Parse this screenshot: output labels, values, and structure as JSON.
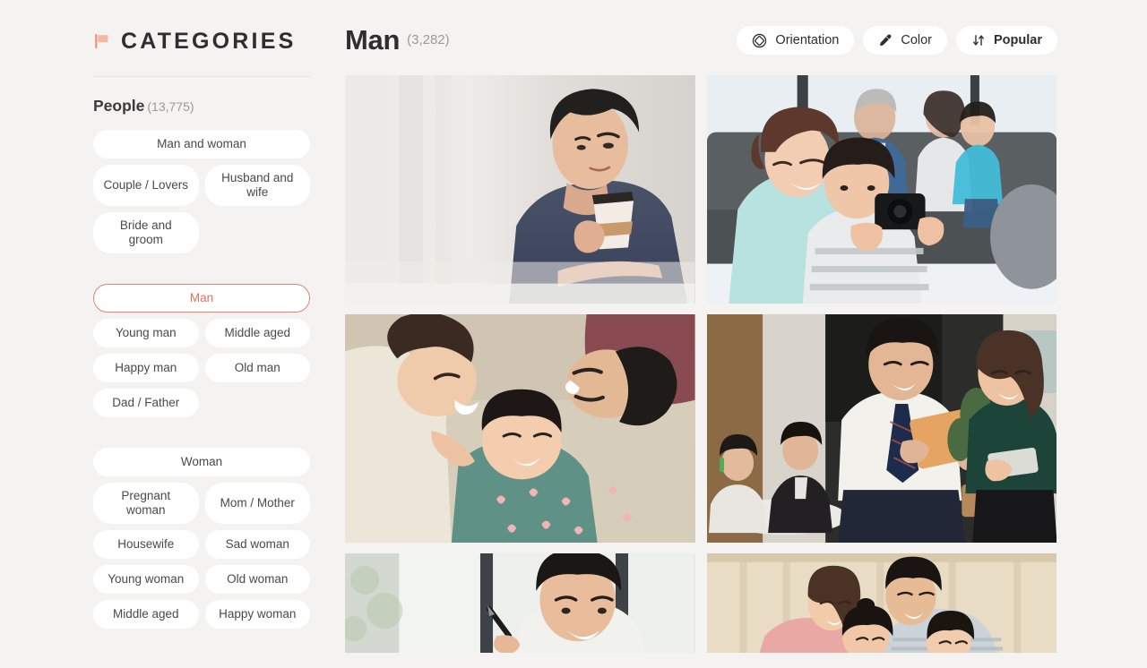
{
  "sidebar": {
    "header": {
      "icon": "flag-icon",
      "title": "CATEGORIES"
    },
    "group": {
      "name": "People",
      "count": "(13,775)"
    },
    "sections": [
      {
        "id": "man-and-woman",
        "pills": [
          {
            "label": "Man and woman",
            "width": "full",
            "selected": false
          },
          {
            "label": "Couple / Lovers",
            "width": "half",
            "selected": false
          },
          {
            "label": "Husband and wife",
            "width": "half",
            "selected": false,
            "two_line": true
          },
          {
            "label": "Bride and groom",
            "width": "half",
            "selected": false,
            "two_line": true
          }
        ]
      },
      {
        "id": "man",
        "pills": [
          {
            "label": "Man",
            "width": "full",
            "selected": true
          },
          {
            "label": "Young man",
            "width": "half",
            "selected": false
          },
          {
            "label": "Middle aged",
            "width": "half",
            "selected": false
          },
          {
            "label": "Happy man",
            "width": "half",
            "selected": false
          },
          {
            "label": "Old man",
            "width": "half",
            "selected": false
          },
          {
            "label": "Dad / Father",
            "width": "half",
            "selected": false
          }
        ]
      },
      {
        "id": "woman",
        "pills": [
          {
            "label": "Woman",
            "width": "full",
            "selected": false
          },
          {
            "label": "Pregnant woman",
            "width": "half",
            "selected": false,
            "two_line": true
          },
          {
            "label": "Mom / Mother",
            "width": "half",
            "selected": false
          },
          {
            "label": "Housewife",
            "width": "half",
            "selected": false
          },
          {
            "label": "Sad woman",
            "width": "half",
            "selected": false
          },
          {
            "label": "Young woman",
            "width": "half",
            "selected": false
          },
          {
            "label": "Old woman",
            "width": "half",
            "selected": false
          },
          {
            "label": "Middle aged",
            "width": "half",
            "selected": false
          },
          {
            "label": "Happy woman",
            "width": "half",
            "selected": false
          }
        ]
      }
    ]
  },
  "main": {
    "title": "Man",
    "count": "(3,282)",
    "filters": [
      {
        "label": "Orientation",
        "icon": "orientation-icon",
        "bold": false
      },
      {
        "label": "Color",
        "icon": "eyedropper-icon",
        "bold": false
      },
      {
        "label": "Popular",
        "icon": "sort-icon",
        "bold": true
      }
    ],
    "gallery": [
      {
        "id": "photo-man-coffee",
        "alt": "Young man holding coffee cup by window"
      },
      {
        "id": "photo-family-camera",
        "alt": "Mother and child with camera, family on sofa"
      },
      {
        "id": "photo-family-lying",
        "alt": "Family lying down laughing together"
      },
      {
        "id": "photo-office-tablet",
        "alt": "Businessman and businesswoman with tablet in office"
      },
      {
        "id": "photo-man-pen",
        "alt": "Smiling man holding pen by window"
      },
      {
        "id": "photo-family-portrait",
        "alt": "Family portrait with two children"
      }
    ]
  },
  "colors": {
    "background": "#f4f3f1",
    "accent": "#e8705a",
    "pill_bg": "#ffffff",
    "text": "#2e2e30",
    "muted": "#9a9a9a"
  }
}
